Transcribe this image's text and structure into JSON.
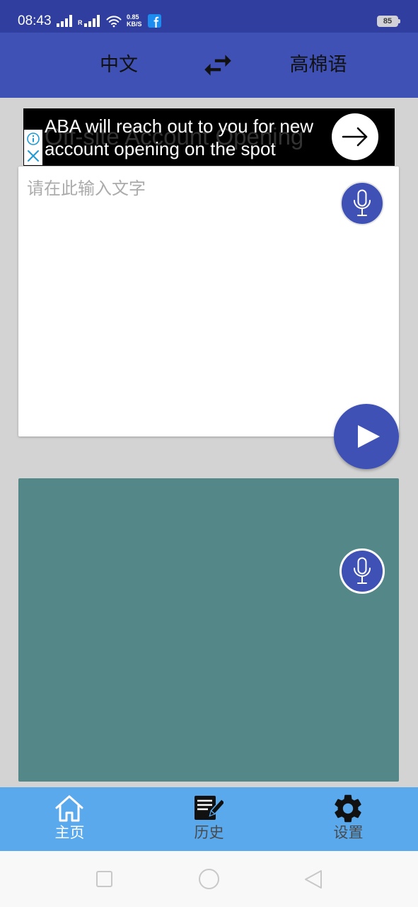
{
  "status_bar": {
    "time": "08:43",
    "roaming_label": "R",
    "net_speed": "0.85",
    "net_speed_unit": "KB/S",
    "battery_level": "85",
    "icons": [
      "cell-signal-icon",
      "wifi-icon",
      "facebook-icon",
      "battery-icon"
    ]
  },
  "app_bar": {
    "source_language": "中文",
    "target_language": "高棉语",
    "swap_icon": "swap-horiz-icon"
  },
  "ad_banner": {
    "headline_lines": [
      "ABA will reach out to you for new",
      "account opening on the spot"
    ],
    "background_text": "Off-site Account Opening",
    "icons": [
      "info-icon",
      "close-icon",
      "arrow-right-icon"
    ]
  },
  "input_card": {
    "placeholder": "请在此输入文字",
    "value": "",
    "mic_icon": "mic-icon"
  },
  "send_button": {
    "icon": "play-icon"
  },
  "output_card": {
    "text": "",
    "mic_icon": "mic-icon"
  },
  "bottom_nav": {
    "items": [
      {
        "label": "主页",
        "icon": "home-icon",
        "active": true
      },
      {
        "label": "历史",
        "icon": "history-note-icon",
        "active": false
      },
      {
        "label": "设置",
        "icon": "settings-gear-icon",
        "active": false
      }
    ]
  },
  "system_nav": {
    "icons": [
      "recent-apps-icon",
      "home-circle-icon",
      "back-triangle-icon"
    ]
  },
  "colors": {
    "status_bar": "#303F9F",
    "primary": "#3F51B5",
    "page_background": "#D3D3D3",
    "ad_background": "#000000",
    "output_card": "#538788",
    "bottom_nav": "#59A9EC",
    "nav_active_label": "#FFFFFF",
    "nav_inactive_label": "#4A4A4A"
  }
}
